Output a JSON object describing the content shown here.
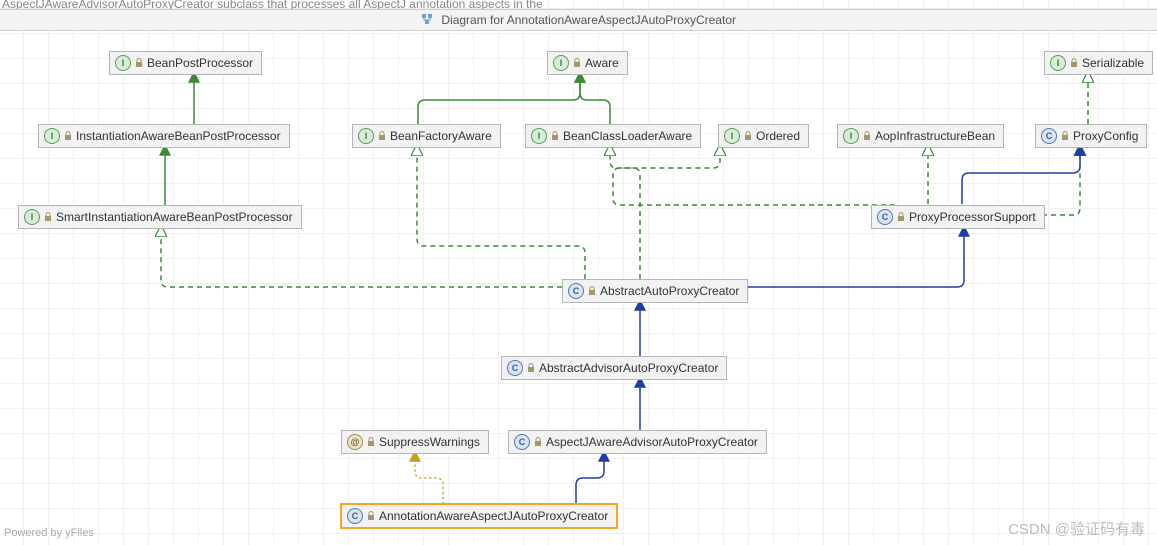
{
  "title": "Diagram for AnnotationAwareAspectJAutoProxyCreator",
  "background": {
    "line1": "AspectJAwareAdvisorAutoProxyCreator subclass that processes all AspectJ annotation aspects in the"
  },
  "nodes": [
    {
      "label": "BeanPostProcessor",
      "kind": "interface"
    },
    {
      "label": "Aware",
      "kind": "interface"
    },
    {
      "label": "Serializable",
      "kind": "interface"
    },
    {
      "label": "InstantiationAwareBeanPostProcessor",
      "kind": "interface"
    },
    {
      "label": "BeanFactoryAware",
      "kind": "interface"
    },
    {
      "label": "BeanClassLoaderAware",
      "kind": "interface"
    },
    {
      "label": "Ordered",
      "kind": "interface"
    },
    {
      "label": "AopInfrastructureBean",
      "kind": "interface"
    },
    {
      "label": "ProxyConfig",
      "kind": "class"
    },
    {
      "label": "SmartInstantiationAwareBeanPostProcessor",
      "kind": "interface"
    },
    {
      "label": "ProxyProcessorSupport",
      "kind": "class"
    },
    {
      "label": "AbstractAutoProxyCreator",
      "kind": "class"
    },
    {
      "label": "AbstractAdvisorAutoProxyCreator",
      "kind": "class"
    },
    {
      "label": "SuppressWarnings",
      "kind": "annotation"
    },
    {
      "label": "AspectJAwareAdvisorAutoProxyCreator",
      "kind": "class"
    },
    {
      "label": "AnnotationAwareAspectJAutoProxyCreator",
      "kind": "class",
      "selected": true
    }
  ],
  "edges": [
    {
      "from": "InstantiationAwareBeanPostProcessor",
      "to": "BeanPostProcessor",
      "type": "extends-interface"
    },
    {
      "from": "BeanFactoryAware",
      "to": "Aware",
      "type": "extends-interface"
    },
    {
      "from": "BeanClassLoaderAware",
      "to": "Aware",
      "type": "extends-interface"
    },
    {
      "from": "SmartInstantiationAwareBeanPostProcessor",
      "to": "InstantiationAwareBeanPostProcessor",
      "type": "extends-interface"
    },
    {
      "from": "ProxyConfig",
      "to": "Serializable",
      "type": "implements"
    },
    {
      "from": "ProxyProcessorSupport",
      "to": "Ordered",
      "type": "implements"
    },
    {
      "from": "ProxyProcessorSupport",
      "to": "BeanClassLoaderAware",
      "type": "implements"
    },
    {
      "from": "ProxyProcessorSupport",
      "to": "AopInfrastructureBean",
      "type": "implements"
    },
    {
      "from": "ProxyProcessorSupport",
      "to": "ProxyConfig",
      "type": "extends-class"
    },
    {
      "from": "AbstractAutoProxyCreator",
      "to": "SmartInstantiationAwareBeanPostProcessor",
      "type": "implements"
    },
    {
      "from": "AbstractAutoProxyCreator",
      "to": "BeanFactoryAware",
      "type": "implements"
    },
    {
      "from": "AbstractAutoProxyCreator",
      "to": "BeanClassLoaderAware",
      "type": "implements"
    },
    {
      "from": "AbstractAutoProxyCreator",
      "to": "ProxyProcessorSupport",
      "type": "extends-class"
    },
    {
      "from": "AbstractAdvisorAutoProxyCreator",
      "to": "AbstractAutoProxyCreator",
      "type": "extends-class"
    },
    {
      "from": "AspectJAwareAdvisorAutoProxyCreator",
      "to": "AbstractAdvisorAutoProxyCreator",
      "type": "extends-class"
    },
    {
      "from": "AnnotationAwareAspectJAutoProxyCreator",
      "to": "AspectJAwareAdvisorAutoProxyCreator",
      "type": "extends-class"
    },
    {
      "from": "AnnotationAwareAspectJAutoProxyCreator",
      "to": "SuppressWarnings",
      "type": "annotated-by"
    }
  ],
  "colors": {
    "interface": "#3a8a3a",
    "class": "#1e3fa0",
    "annotation": "#c0a020",
    "nodeBg": "#f2f2f2",
    "selected": "#f5a623"
  },
  "footer": {
    "powered": "Powered by yFiles",
    "watermark": "CSDN @验证码有毒"
  }
}
